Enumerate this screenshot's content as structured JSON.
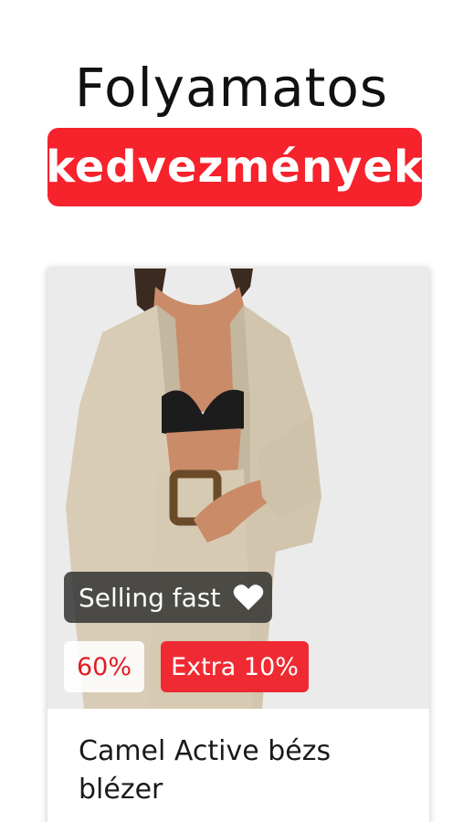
{
  "promo": {
    "headline": "Folyamatos",
    "highlight": "kedvezmények",
    "highlight_color": "#f6222c"
  },
  "product_card": {
    "badges": {
      "selling_fast": "Selling fast",
      "discount": "60%",
      "extra": "Extra 10%"
    },
    "name": "Camel Active bézs blézer",
    "icons": [
      "heart-icon"
    ]
  }
}
